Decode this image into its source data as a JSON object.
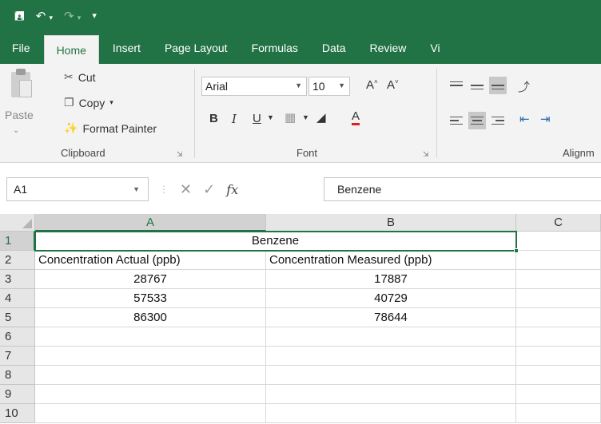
{
  "quick_access": {
    "save_icon": "save-icon",
    "undo_icon": "undo-icon",
    "redo_icon": "redo-icon",
    "customize_icon": "customize-icon"
  },
  "tabs": [
    {
      "label": "File",
      "active": false
    },
    {
      "label": "Home",
      "active": true
    },
    {
      "label": "Insert",
      "active": false
    },
    {
      "label": "Page Layout",
      "active": false
    },
    {
      "label": "Formulas",
      "active": false
    },
    {
      "label": "Data",
      "active": false
    },
    {
      "label": "Review",
      "active": false
    },
    {
      "label": "Vi",
      "active": false
    }
  ],
  "clipboard": {
    "paste_label": "Paste",
    "cut_label": "Cut",
    "copy_label": "Copy",
    "format_painter_label": "Format Painter",
    "group_label": "Clipboard"
  },
  "font": {
    "font_name": "Arial",
    "font_size": "10",
    "group_label": "Font"
  },
  "alignment": {
    "group_label": "Alignm"
  },
  "formula_bar": {
    "name_box": "A1",
    "fx_label": "fx",
    "content": "Benzene"
  },
  "sheet": {
    "columns": [
      "A",
      "B",
      "C"
    ],
    "selected_column": "A",
    "rows": [
      "1",
      "2",
      "3",
      "4",
      "5",
      "6",
      "7",
      "8",
      "9",
      "10"
    ],
    "selected_row": "1",
    "title_cell": "Benzene",
    "header_a": "Concentration Actual (ppb)",
    "header_b": "Concentration Measured (ppb)",
    "data": [
      {
        "a": "28767",
        "b": "17887"
      },
      {
        "a": "57533",
        "b": "40729"
      },
      {
        "a": "86300",
        "b": "78644"
      }
    ]
  },
  "colors": {
    "excel_green": "#217346",
    "ribbon_bg": "#f3f3f3",
    "header_bg": "#e6e6e6"
  }
}
